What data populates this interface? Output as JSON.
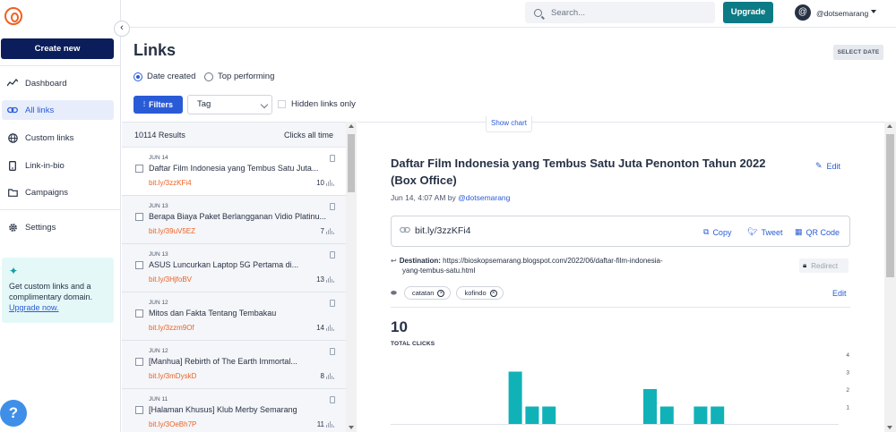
{
  "sidebar": {
    "create_label": "Create new",
    "items": [
      {
        "label": "Dashboard",
        "icon": "trend-icon"
      },
      {
        "label": "All links",
        "icon": "link-icon"
      },
      {
        "label": "Custom links",
        "icon": "globe-icon"
      },
      {
        "label": "Link-in-bio",
        "icon": "phone-icon"
      },
      {
        "label": "Campaigns",
        "icon": "folder-icon"
      },
      {
        "label": "Settings",
        "icon": "gear-icon"
      }
    ],
    "promo": {
      "text": "Get custom links and a complimentary domain.",
      "link": "Upgrade now."
    },
    "help": "?"
  },
  "topbar": {
    "search_placeholder": "Search...",
    "upgrade_label": "Upgrade",
    "avatar": "@",
    "username": "@dotsemarang"
  },
  "page": {
    "title": "Links",
    "select_date": "SELECT DATE",
    "radio_date": "Date created",
    "radio_top": "Top performing",
    "filters_label": "Filters",
    "tag_placeholder": "Tag",
    "hidden_links": "Hidden links only"
  },
  "list": {
    "results": "10114 Results",
    "clicks_all_time": "Clicks all time",
    "items": [
      {
        "date": "JUN 14",
        "title": "Daftar Film Indonesia yang Tembus Satu Juta...",
        "link": "bit.ly/3zzKFi4",
        "clicks": "10"
      },
      {
        "date": "JUN 13",
        "title": "Berapa Biaya Paket Berlangganan Vidio Platinu...",
        "link": "bit.ly/39uV5EZ",
        "clicks": "7"
      },
      {
        "date": "JUN 13",
        "title": "ASUS Luncurkan Laptop 5G Pertama di...",
        "link": "bit.ly/3HjfoBV",
        "clicks": "13"
      },
      {
        "date": "JUN 12",
        "title": "Mitos dan Fakta Tentang Tembakau",
        "link": "bit.ly/3zzm9Of",
        "clicks": "14"
      },
      {
        "date": "JUN 12",
        "title": "[Manhua] Rebirth of The Earth Immortal...",
        "link": "bit.ly/3mDyskD",
        "clicks": "8"
      },
      {
        "date": "JUN 11",
        "title": "[Halaman Khusus] Klub Merby Semarang",
        "link": "bit.ly/3OeBh7P",
        "clicks": "11"
      }
    ]
  },
  "detail": {
    "show_chart": "Show chart",
    "title": "Daftar Film Indonesia yang Tembus Satu Juta Penonton Tahun 2022 (Box Office)",
    "edit": "Edit",
    "meta_date": "Jun 14, 4:07 AM by ",
    "meta_user": "@dotsemarang",
    "short_link": "bit.ly/3zzKFi4",
    "copy": "Copy",
    "tweet": "Tweet",
    "qr": "QR Code",
    "destination_label": "Destination:",
    "destination_url_1": "https://bioskopsemarang.blogspot.com/2022/06/daftar-film-indonesia-",
    "destination_url_2": "yang-tembus-satu.html",
    "redirect": "Redirect",
    "tags": [
      "catatan",
      "kofindo"
    ],
    "tags_edit": "Edit",
    "total_clicks": "10",
    "total_clicks_label": "TOTAL CLICKS"
  },
  "chart_data": {
    "type": "bar",
    "values": [
      0,
      0,
      0,
      0,
      0,
      0,
      0,
      3,
      1,
      1,
      0,
      0,
      0,
      0,
      0,
      2,
      1,
      0,
      1,
      1,
      0,
      0,
      0,
      0,
      0
    ],
    "yticks": [
      "4",
      "3",
      "2",
      "1"
    ],
    "ylim": [
      0,
      4
    ],
    "color": "#10b2b8"
  }
}
